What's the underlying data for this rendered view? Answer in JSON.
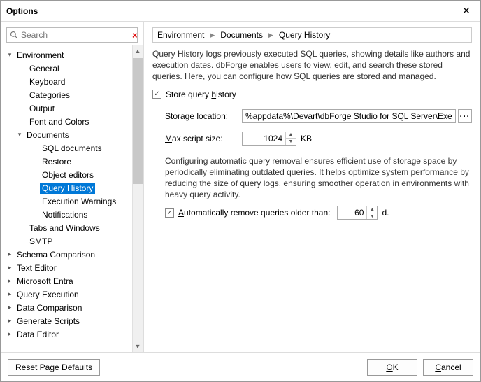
{
  "title": "Options",
  "search": {
    "placeholder": "Search"
  },
  "tree": {
    "environment": "Environment",
    "general": "General",
    "keyboard": "Keyboard",
    "categories": "Categories",
    "output": "Output",
    "fonts": "Font and Colors",
    "documents": "Documents",
    "sql_docs": "SQL documents",
    "restore": "Restore",
    "object_editors": "Object editors",
    "query_history": "Query History",
    "exec_warnings": "Execution Warnings",
    "notifications": "Notifications",
    "tabs_windows": "Tabs and Windows",
    "smtp": "SMTP",
    "schema_comp": "Schema Comparison",
    "text_editor": "Text Editor",
    "ms_entra": "Microsoft Entra",
    "query_exec": "Query Execution",
    "data_comp": "Data Comparison",
    "gen_scripts": "Generate Scripts",
    "data_editor": "Data Editor"
  },
  "crumbs": {
    "a": "Environment",
    "b": "Documents",
    "c": "Query History"
  },
  "desc": "Query History logs previously executed SQL queries, showing details like authors and execution dates. dbForge enables users to view, edit, and search these stored queries. Here, you can configure how SQL queries are stored and managed.",
  "store_chk_pre": "Store query ",
  "store_chk_u": "h",
  "store_chk_post": "istory",
  "storage_pre": "Storage ",
  "storage_u": "l",
  "storage_post": "ocation:",
  "storage_val": "%appdata%\\Devart\\dbForge Studio for SQL Server\\ExecutedQuerie",
  "max_u": "M",
  "max_post": "ax script size:",
  "max_val": "1024",
  "max_unit": "KB",
  "desc2": "Configuring automatic query removal ensures efficient use of storage space by periodically eliminating outdated queries. It helps optimize system performance by reducing the size of query logs, ensuring smoother operation in environments with heavy query activity.",
  "auto_u": "A",
  "auto_post": "utomatically remove queries older than:",
  "auto_val": "60",
  "auto_unit": "d.",
  "footer": {
    "reset": "Reset Page Defaults",
    "ok_u": "O",
    "ok_post": "K",
    "cancel": "Cancel"
  }
}
